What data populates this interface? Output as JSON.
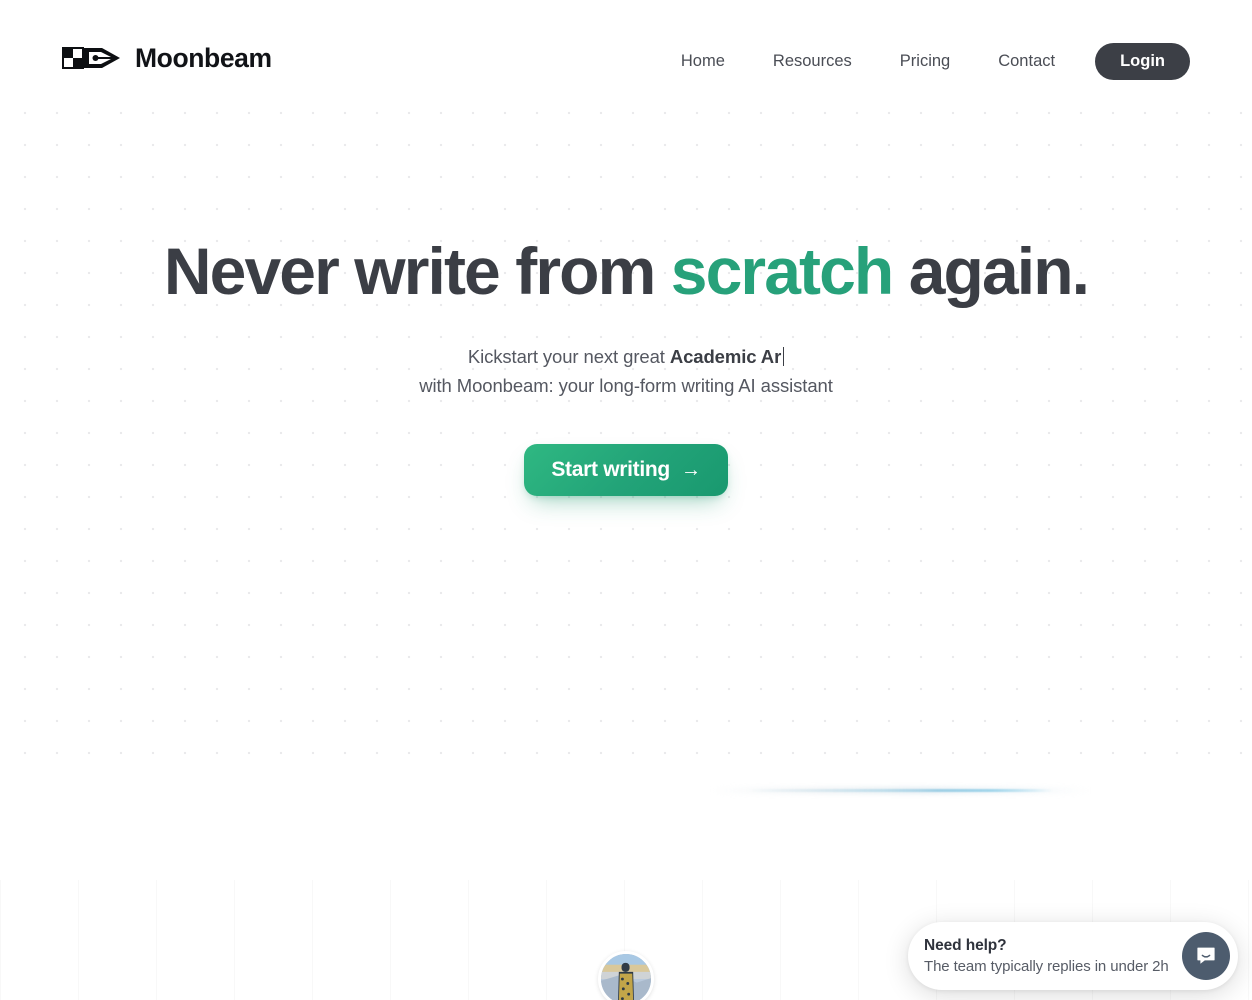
{
  "brand": {
    "name": "Moonbeam",
    "logo_icon": "pen-nib-checker-icon"
  },
  "nav": {
    "items": [
      {
        "label": "Home"
      },
      {
        "label": "Resources"
      },
      {
        "label": "Pricing"
      },
      {
        "label": "Contact"
      }
    ],
    "login_label": "Login"
  },
  "hero": {
    "title_part1": "Never write from ",
    "title_accent": "scratch",
    "title_part2": " again.",
    "subtitle_prefix": "Kickstart your next great ",
    "subtitle_typed": "Academic Ar",
    "subtitle_line2": "with Moonbeam: your long-form writing AI assistant",
    "cta_label": "Start writing",
    "cta_arrow_icon": "arrow-right-icon"
  },
  "chat": {
    "title": "Need help?",
    "subtitle": "The team typically replies in under 2h",
    "bubble_icon": "chat-bubble-smile-icon"
  },
  "avatar": {
    "name": "user-avatar-photo"
  },
  "colors": {
    "accent_green": "#27a17a",
    "cta_green": "#22a378",
    "dark": "#3c3f46",
    "text": "#3b3e45",
    "muted": "#555861",
    "chat_slate": "#4d5c6e",
    "dot_grid": "#eaeaec"
  }
}
